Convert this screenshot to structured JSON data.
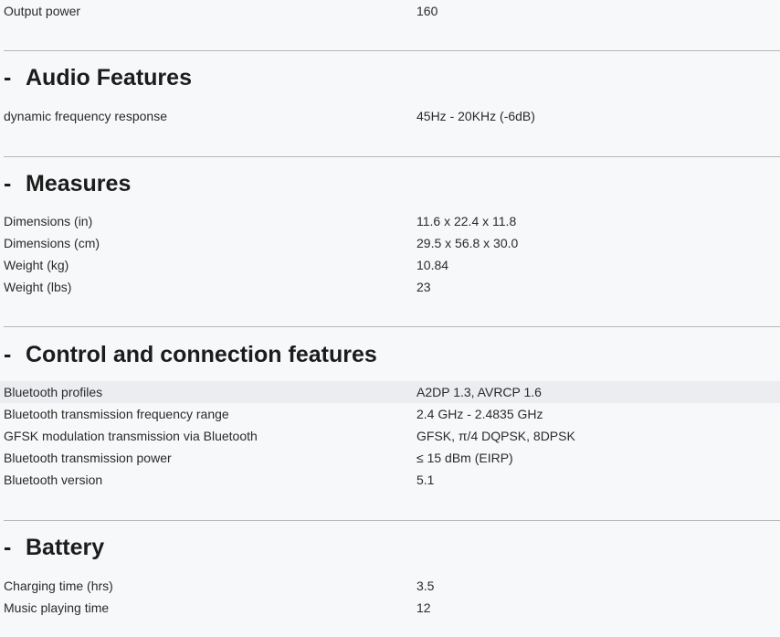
{
  "top": {
    "rows": [
      {
        "label": "Output power",
        "value": "160"
      }
    ]
  },
  "sections": [
    {
      "toggle": "-",
      "title": "Audio Features",
      "rows": [
        {
          "label": "dynamic frequency response",
          "value": "45Hz - 20KHz (-6dB)"
        }
      ]
    },
    {
      "toggle": "-",
      "title": "Measures",
      "rows": [
        {
          "label": "Dimensions (in)",
          "value": "11.6 x 22.4 x 11.8"
        },
        {
          "label": "Dimensions (cm)",
          "value": "29.5 x 56.8 x 30.0"
        },
        {
          "label": "Weight (kg)",
          "value": "10.84"
        },
        {
          "label": "Weight (lbs)",
          "value": "23"
        }
      ]
    },
    {
      "toggle": "-",
      "title": "Control and connection features",
      "rows": [
        {
          "label": "Bluetooth profiles",
          "value": "A2DP 1.3, AVRCP 1.6"
        },
        {
          "label": "Bluetooth transmission frequency range",
          "value": "2.4 GHz - 2.4835 GHz"
        },
        {
          "label": "GFSK modulation transmission via Bluetooth",
          "value": "GFSK, π/4 DQPSK, 8DPSK"
        },
        {
          "label": "Bluetooth transmission power",
          "value": "≤ 15 dBm (EIRP)"
        },
        {
          "label": "Bluetooth version",
          "value": "5.1"
        }
      ]
    },
    {
      "toggle": "-",
      "title": "Battery",
      "rows": [
        {
          "label": "Charging time (hrs)",
          "value": "3.5"
        },
        {
          "label": "Music playing time",
          "value": "12"
        }
      ]
    }
  ]
}
